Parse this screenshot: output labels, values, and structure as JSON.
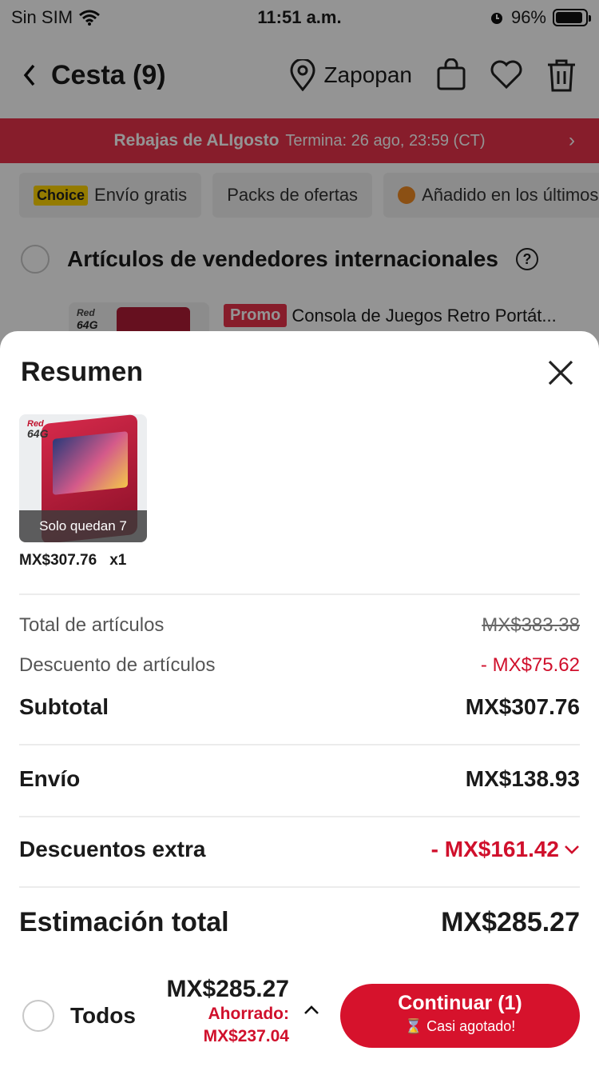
{
  "status_bar": {
    "carrier": "Sin SIM",
    "time": "11:51 a.m.",
    "battery": "96%"
  },
  "header": {
    "back": "<",
    "title": "Cesta (9)",
    "location": "Zapopan"
  },
  "promo_banner": {
    "brand": "Rebajas de ALIgosto",
    "ends": "Termina: 26 ago, 23:59 (CT)",
    "chevron": "›"
  },
  "chips": {
    "choice_tag": "Choice",
    "free_shipping": "Envío gratis",
    "bundles": "Packs de ofertas",
    "recent": "Añadido en los últimos"
  },
  "section": {
    "title": "Artículos de vendedores internacionales",
    "help": "?"
  },
  "item": {
    "preview_label_a": "Red",
    "preview_label_b": "64G",
    "promo_tag": "Promo",
    "title": "Consola de Juegos Retro Portát..."
  },
  "sheet": {
    "title": "Resumen",
    "thumb_label_color": "Red",
    "thumb_label_storage": "64G",
    "stock": "Solo quedan 7",
    "unit_price": "MX$307.76",
    "quantity": "x1",
    "rows": {
      "items_total_label": "Total de artículos",
      "items_total_value": "MX$383.38",
      "items_discount_label": "Descuento de artículos",
      "items_discount_value": "- MX$75.62",
      "subtotal_label": "Subtotal",
      "subtotal_value": "MX$307.76",
      "shipping_label": "Envío",
      "shipping_value": "MX$138.93",
      "extra_label": "Descuentos extra",
      "extra_value": "- MX$161.42",
      "estimate_label": "Estimación total",
      "estimate_value": "MX$285.27"
    }
  },
  "bottom_bar": {
    "select_all": "Todos",
    "total": "MX$285.27",
    "saved_label": "Ahorrado:",
    "saved_value": "MX$237.04",
    "caret": "^",
    "cta_label": "Continuar (1)",
    "cta_sub": "⌛ Casi agotado!"
  },
  "colors": {
    "brand_red": "#d6122c",
    "banner_red": "#e8324a",
    "choice_yellow": "#ffd400"
  }
}
